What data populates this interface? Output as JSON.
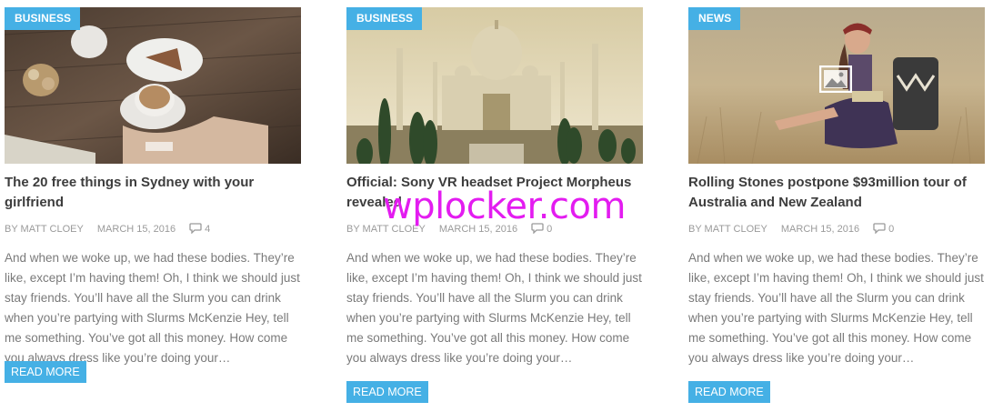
{
  "posts": [
    {
      "category": "BUSINESS",
      "title": "The 20 free things in Sydney with your girlfriend",
      "author": "BY MATT CLOEY",
      "date": "MARCH 15, 2016",
      "comments": "4",
      "excerpt": "And when we woke up, we had these bodies. They’re like, except I’m having them! Oh, I think we should just stay friends. You’ll have all the Slurm you can drink when you’re partying with Slurms McKenzie Hey, tell me something. You’ve got all this money. How come you always dress like you’re doing your…",
      "button": "READ MORE"
    },
    {
      "category": "BUSINESS",
      "title": "Official: Sony VR headset Project Morpheus revealed",
      "author": "BY MATT CLOEY",
      "date": "MARCH 15, 2016",
      "comments": "0",
      "excerpt": "And when we woke up, we had these bodies. They’re like, except I’m having them! Oh, I think we should just stay friends. You’ll have all the Slurm you can drink when you’re partying with Slurms McKenzie Hey, tell me something. You’ve got all this money. How come you always dress like you’re doing your…",
      "button": "READ MORE"
    },
    {
      "category": "NEWS",
      "title": "Rolling Stones postpone $93million tour of Australia and New Zealand",
      "author": "BY MATT CLOEY",
      "date": "MARCH 15, 2016",
      "comments": "0",
      "excerpt": "And when we woke up, we had these bodies. They’re like, except I’m having them! Oh, I think we should just stay friends. You’ll have all the Slurm you can drink when you’re partying with Slurms McKenzie Hey, tell me something. You’ve got all this money. How come you always dress like you’re doing your…",
      "button": "READ MORE"
    }
  ],
  "watermark": "wplocker.com",
  "colors": {
    "accent": "#45b0e5",
    "watermark": "#e31cf0"
  }
}
